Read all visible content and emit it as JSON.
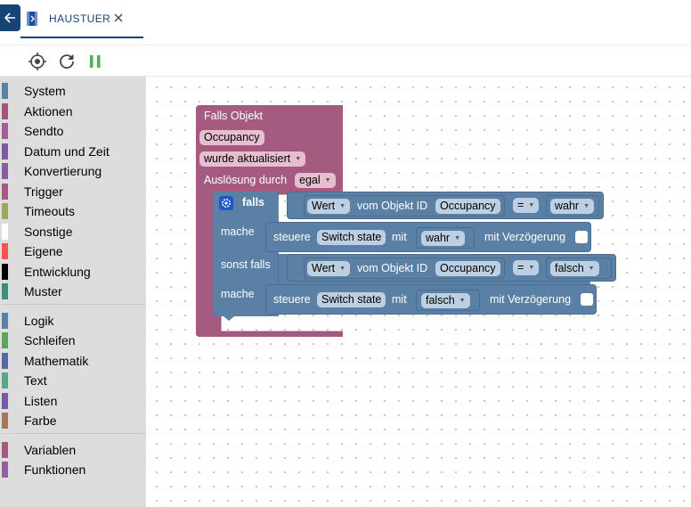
{
  "tab": {
    "title": "HAUSTUER"
  },
  "toolbar": {
    "target_icon": "crosshair-icon",
    "refresh_icon": "refresh-icon",
    "pause_icon": "pause-icon"
  },
  "sidebar": {
    "categories": [
      {
        "label": "System",
        "color": "#5b80a5"
      },
      {
        "label": "Aktionen",
        "color": "#a5557a"
      },
      {
        "label": "Sendto",
        "color": "#a55b99"
      },
      {
        "label": "Datum und Zeit",
        "color": "#7b5ba5"
      },
      {
        "label": "Konvertierung",
        "color": "#885ba5"
      },
      {
        "label": "Trigger",
        "color": "#a55b80"
      },
      {
        "label": "Timeouts",
        "color": "#9fa55b"
      },
      {
        "label": "Sonstige",
        "color": "#ffffff"
      },
      {
        "label": "Eigene",
        "color": "#ff4f4f"
      },
      {
        "label": "Entwicklung",
        "color": "#000000"
      },
      {
        "label": "Muster",
        "color": "#3d8c7c"
      },
      {
        "label": "Logik",
        "color": "#5b80a5"
      },
      {
        "label": "Schleifen",
        "color": "#5ba55b"
      },
      {
        "label": "Mathematik",
        "color": "#5b67a5"
      },
      {
        "label": "Text",
        "color": "#5ba58c"
      },
      {
        "label": "Listen",
        "color": "#745ba5"
      },
      {
        "label": "Farbe",
        "color": "#a5745b"
      },
      {
        "label": "Variablen",
        "color": "#a55b80"
      },
      {
        "label": "Funktionen",
        "color": "#995ba5"
      }
    ]
  },
  "trigger_block": {
    "title": "Falls Objekt",
    "object": "Occupancy",
    "event": "wurde aktualisiert",
    "source_label": "Auslösung durch",
    "source": "egal"
  },
  "if_block": {
    "if_label": "falls",
    "then_label": "mache",
    "else_if_label": "sonst falls",
    "condition1": {
      "prop": "Wert",
      "of_label": "vom Objekt ID",
      "object": "Occupancy",
      "op": "=",
      "value": "wahr"
    },
    "action1": {
      "control_label": "steuere",
      "object": "Switch state",
      "with_label": "mit",
      "value": "wahr",
      "delay_label": "mit Verzögerung"
    },
    "condition2": {
      "prop": "Wert",
      "of_label": "vom Objekt ID",
      "object": "Occupancy",
      "op": "=",
      "value": "falsch"
    },
    "action2": {
      "control_label": "steuere",
      "object": "Switch state",
      "with_label": "mit",
      "value": "falsch",
      "delay_label": "mit Verzögerung"
    }
  }
}
